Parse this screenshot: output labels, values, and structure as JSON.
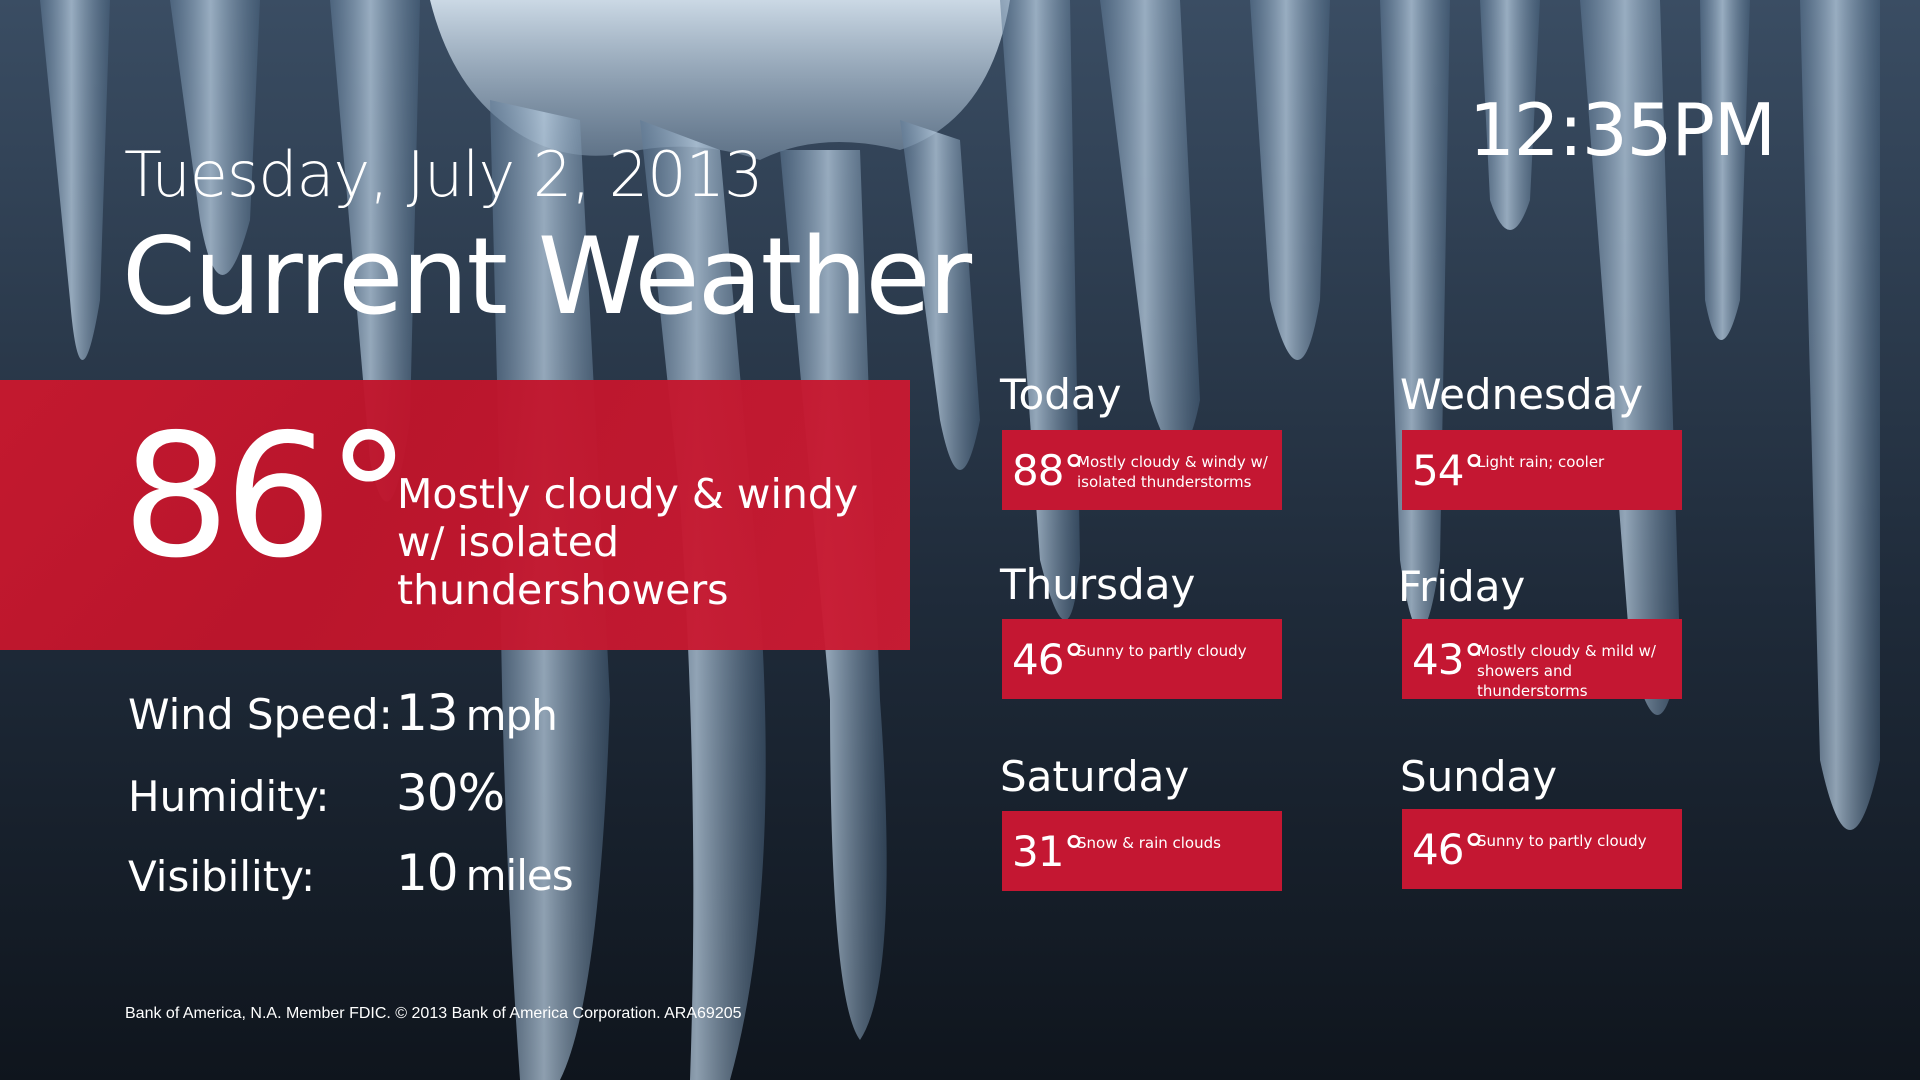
{
  "header": {
    "date": "Tuesday, July 2, 2013",
    "title": "Current Weather",
    "time": "12:35PM"
  },
  "current": {
    "temp": "86°",
    "condition": "Mostly cloudy & windy w/ isolated thundershowers"
  },
  "stats": [
    {
      "label": "Wind Speed:",
      "value": "13",
      "unit": "mph"
    },
    {
      "label": "Humidity:",
      "value": "30%",
      "unit": ""
    },
    {
      "label": "Visibility:",
      "value": "10",
      "unit": "miles"
    }
  ],
  "forecast": [
    {
      "day": "Today",
      "temp": "88°",
      "condition": "Mostly cloudy & windy w/ isolated thunderstorms"
    },
    {
      "day": "Wednesday",
      "temp": "54°",
      "condition": "Light rain; cooler"
    },
    {
      "day": "Thursday",
      "temp": "46°",
      "condition": "Sunny to partly cloudy"
    },
    {
      "day": "Friday",
      "temp": "43°",
      "condition": "Mostly cloudy & mild w/ showers and thunderstorms"
    },
    {
      "day": "Saturday",
      "temp": "31°",
      "condition": "Snow & rain clouds"
    },
    {
      "day": "Sunday",
      "temp": "46°",
      "condition": "Sunny to partly cloudy"
    }
  ],
  "footer": "Bank of America, N.A. Member FDIC. © 2013 Bank of America Corporation. ARA69205",
  "colors": {
    "accent": "#c41732",
    "background": "#1b2430",
    "text": "#ffffff"
  },
  "background_image": "icicles-photo"
}
